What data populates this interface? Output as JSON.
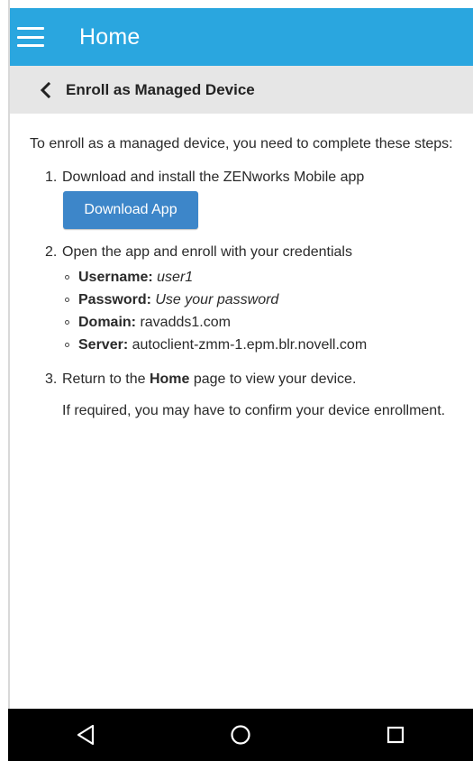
{
  "app_bar": {
    "title": "Home",
    "menu_icon": "hamburger-menu-icon",
    "color": "#2aa6df"
  },
  "sub_bar": {
    "title": "Enroll as Managed Device",
    "back_icon": "chevron-left-icon"
  },
  "content": {
    "intro": "To enroll as a managed device, you need to complete these steps:",
    "steps": [
      {
        "number": "1.",
        "text": "Download and install the ZENworks Mobile app",
        "button_label": "Download App"
      },
      {
        "number": "2.",
        "text": "Open the app and enroll with your credentials",
        "credentials": [
          {
            "label": "Username:",
            "value": "user1"
          },
          {
            "label": "Password:",
            "value": "Use your password"
          },
          {
            "label": "Domain:",
            "value": "ravadds1.com"
          },
          {
            "label": "Server:",
            "value": "autoclient-zmm-1.epm.blr.novell.com"
          }
        ]
      },
      {
        "number": "3.",
        "text_before": "Return to the ",
        "text_bold": "Home",
        "text_after": " page to view your device.",
        "note": "If required, you may have to confirm your device enrollment."
      }
    ]
  },
  "nav_bar": {
    "back_icon": "triangle-back-icon",
    "home_icon": "circle-home-icon",
    "recents_icon": "square-recents-icon"
  },
  "colors": {
    "accent": "#2aa6df",
    "button": "#3d86c9",
    "subbar": "#e6e6e6"
  }
}
